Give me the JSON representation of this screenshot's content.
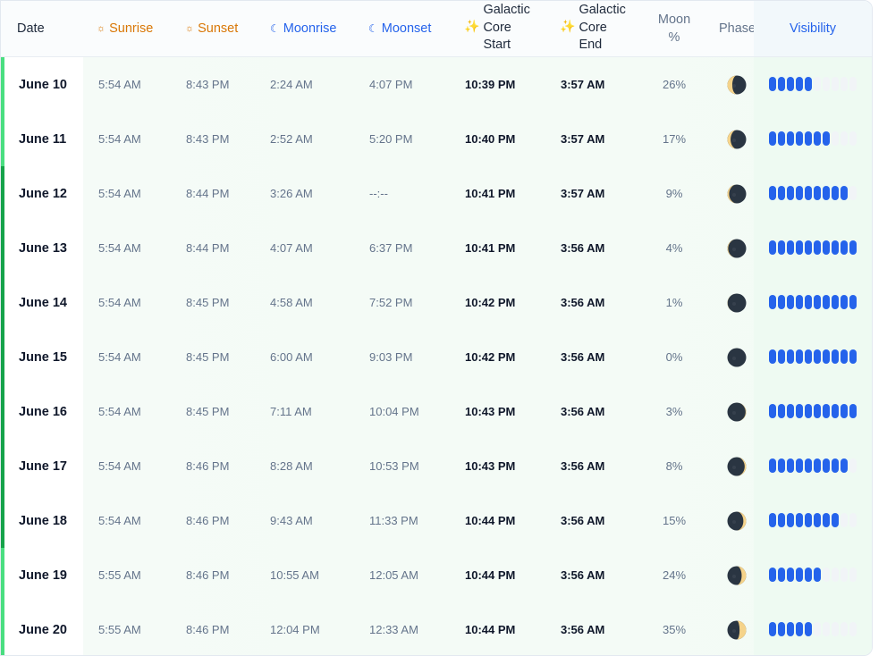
{
  "header": {
    "date": "Date",
    "sunrise": "Sunrise",
    "sunset": "Sunset",
    "moonrise": "Moonrise",
    "moonset": "Moonset",
    "gc_start": [
      "Galactic",
      "Core",
      "Start"
    ],
    "gc_end": [
      "Galactic",
      "Core",
      "End"
    ],
    "moon_pct": [
      "Moon",
      "%"
    ],
    "phase": "Phase",
    "visibility": "Visibility",
    "icons": {
      "sunrise": "sun-icon",
      "sunset": "sun-icon",
      "moonrise": "crescent-moon-icon",
      "moonset": "crescent-moon-icon",
      "galactic_core": "sparkles-icon"
    }
  },
  "colors": {
    "accent_green": "#4ade80",
    "accent_dark_green": "#16a34a",
    "bar_on": "#2563eb",
    "bar_off": "#f1f4f7",
    "sun_header": "#d97706",
    "moon_header": "#2563eb"
  },
  "rows": [
    {
      "date": "June 10",
      "sunrise": "5:54 AM",
      "sunset": "8:43 PM",
      "moonrise": "2:24 AM",
      "moonset": "4:07 PM",
      "gc_start": "10:39 PM",
      "gc_end": "3:57 AM",
      "moon_pct": "26%",
      "phase_icon": "waning-crescent-moon-icon",
      "illumination": 0.26,
      "waxing": false,
      "visibility": 5,
      "accent": "#4ade80"
    },
    {
      "date": "June 11",
      "sunrise": "5:54 AM",
      "sunset": "8:43 PM",
      "moonrise": "2:52 AM",
      "moonset": "5:20 PM",
      "gc_start": "10:40 PM",
      "gc_end": "3:57 AM",
      "moon_pct": "17%",
      "phase_icon": "waning-crescent-moon-icon",
      "illumination": 0.17,
      "waxing": false,
      "visibility": 7,
      "accent": "#4ade80"
    },
    {
      "date": "June 12",
      "sunrise": "5:54 AM",
      "sunset": "8:44 PM",
      "moonrise": "3:26 AM",
      "moonset": "--:--",
      "gc_start": "10:41 PM",
      "gc_end": "3:57 AM",
      "moon_pct": "9%",
      "phase_icon": "waning-crescent-moon-icon",
      "illumination": 0.09,
      "waxing": false,
      "visibility": 9,
      "accent": "#16a34a"
    },
    {
      "date": "June 13",
      "sunrise": "5:54 AM",
      "sunset": "8:44 PM",
      "moonrise": "4:07 AM",
      "moonset": "6:37 PM",
      "gc_start": "10:41 PM",
      "gc_end": "3:56 AM",
      "moon_pct": "4%",
      "phase_icon": "new-moon-icon",
      "illumination": 0.04,
      "waxing": false,
      "visibility": 10,
      "accent": "#16a34a"
    },
    {
      "date": "June 14",
      "sunrise": "5:54 AM",
      "sunset": "8:45 PM",
      "moonrise": "4:58 AM",
      "moonset": "7:52 PM",
      "gc_start": "10:42 PM",
      "gc_end": "3:56 AM",
      "moon_pct": "1%",
      "phase_icon": "new-moon-icon",
      "illumination": 0.01,
      "waxing": false,
      "visibility": 10,
      "accent": "#16a34a"
    },
    {
      "date": "June 15",
      "sunrise": "5:54 AM",
      "sunset": "8:45 PM",
      "moonrise": "6:00 AM",
      "moonset": "9:03 PM",
      "gc_start": "10:42 PM",
      "gc_end": "3:56 AM",
      "moon_pct": "0%",
      "phase_icon": "new-moon-icon",
      "illumination": 0.0,
      "waxing": true,
      "visibility": 10,
      "accent": "#16a34a"
    },
    {
      "date": "June 16",
      "sunrise": "5:54 AM",
      "sunset": "8:45 PM",
      "moonrise": "7:11 AM",
      "moonset": "10:04 PM",
      "gc_start": "10:43 PM",
      "gc_end": "3:56 AM",
      "moon_pct": "3%",
      "phase_icon": "new-moon-icon",
      "illumination": 0.03,
      "waxing": true,
      "visibility": 10,
      "accent": "#16a34a"
    },
    {
      "date": "June 17",
      "sunrise": "5:54 AM",
      "sunset": "8:46 PM",
      "moonrise": "8:28 AM",
      "moonset": "10:53 PM",
      "gc_start": "10:43 PM",
      "gc_end": "3:56 AM",
      "moon_pct": "8%",
      "phase_icon": "waxing-crescent-moon-icon",
      "illumination": 0.08,
      "waxing": true,
      "visibility": 9,
      "accent": "#16a34a"
    },
    {
      "date": "June 18",
      "sunrise": "5:54 AM",
      "sunset": "8:46 PM",
      "moonrise": "9:43 AM",
      "moonset": "11:33 PM",
      "gc_start": "10:44 PM",
      "gc_end": "3:56 AM",
      "moon_pct": "15%",
      "phase_icon": "waxing-crescent-moon-icon",
      "illumination": 0.15,
      "waxing": true,
      "visibility": 8,
      "accent": "#16a34a"
    },
    {
      "date": "June 19",
      "sunrise": "5:55 AM",
      "sunset": "8:46 PM",
      "moonrise": "10:55 AM",
      "moonset": "12:05 AM",
      "gc_start": "10:44 PM",
      "gc_end": "3:56 AM",
      "moon_pct": "24%",
      "phase_icon": "waxing-crescent-moon-icon",
      "illumination": 0.24,
      "waxing": true,
      "visibility": 6,
      "accent": "#4ade80"
    },
    {
      "date": "June 20",
      "sunrise": "5:55 AM",
      "sunset": "8:46 PM",
      "moonrise": "12:04 PM",
      "moonset": "12:33 AM",
      "gc_start": "10:44 PM",
      "gc_end": "3:56 AM",
      "moon_pct": "35%",
      "phase_icon": "waxing-crescent-moon-icon",
      "illumination": 0.35,
      "waxing": true,
      "visibility": 5,
      "accent": "#4ade80"
    }
  ],
  "visibility_max": 10
}
